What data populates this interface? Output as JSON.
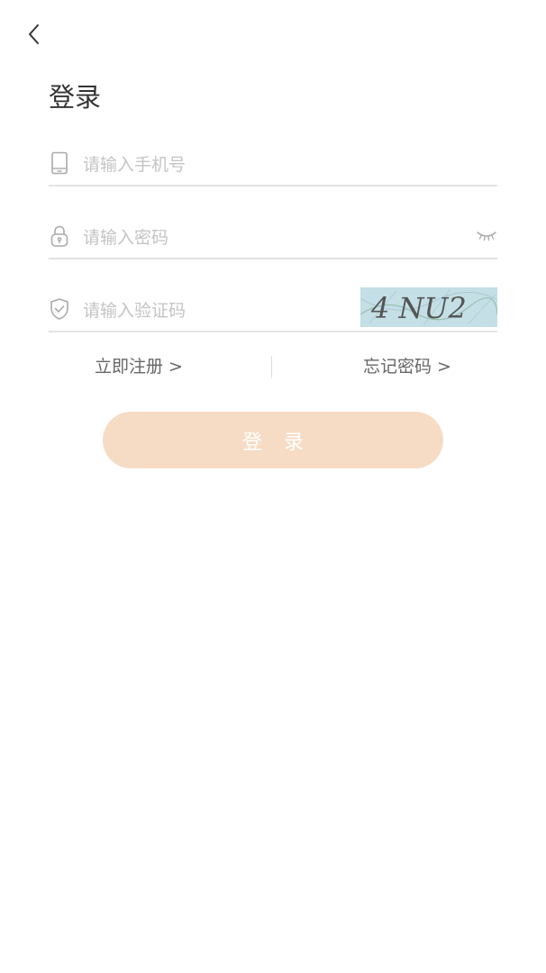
{
  "header": {
    "back_icon": "chevron-left-icon",
    "title": "登录"
  },
  "form": {
    "phone": {
      "icon": "phone-icon",
      "value": "",
      "placeholder": "请输入手机号"
    },
    "password": {
      "icon": "lock-icon",
      "value": "",
      "placeholder": "请输入密码",
      "toggle_icon": "eye-closed-icon"
    },
    "captcha": {
      "icon": "shield-check-icon",
      "value": "",
      "placeholder": "请输入验证码",
      "image_text": "4 NU2"
    }
  },
  "links": {
    "register_label": "立即注册 >",
    "forgot_label": "忘记密码 >"
  },
  "login_button": {
    "label": "登录",
    "background": "#f6dcc4"
  },
  "colors": {
    "text_primary": "#333333",
    "text_secondary": "#666666",
    "placeholder": "#c4c4c4",
    "divider": "#e3e3e3",
    "accent": "#f6dcc4"
  }
}
